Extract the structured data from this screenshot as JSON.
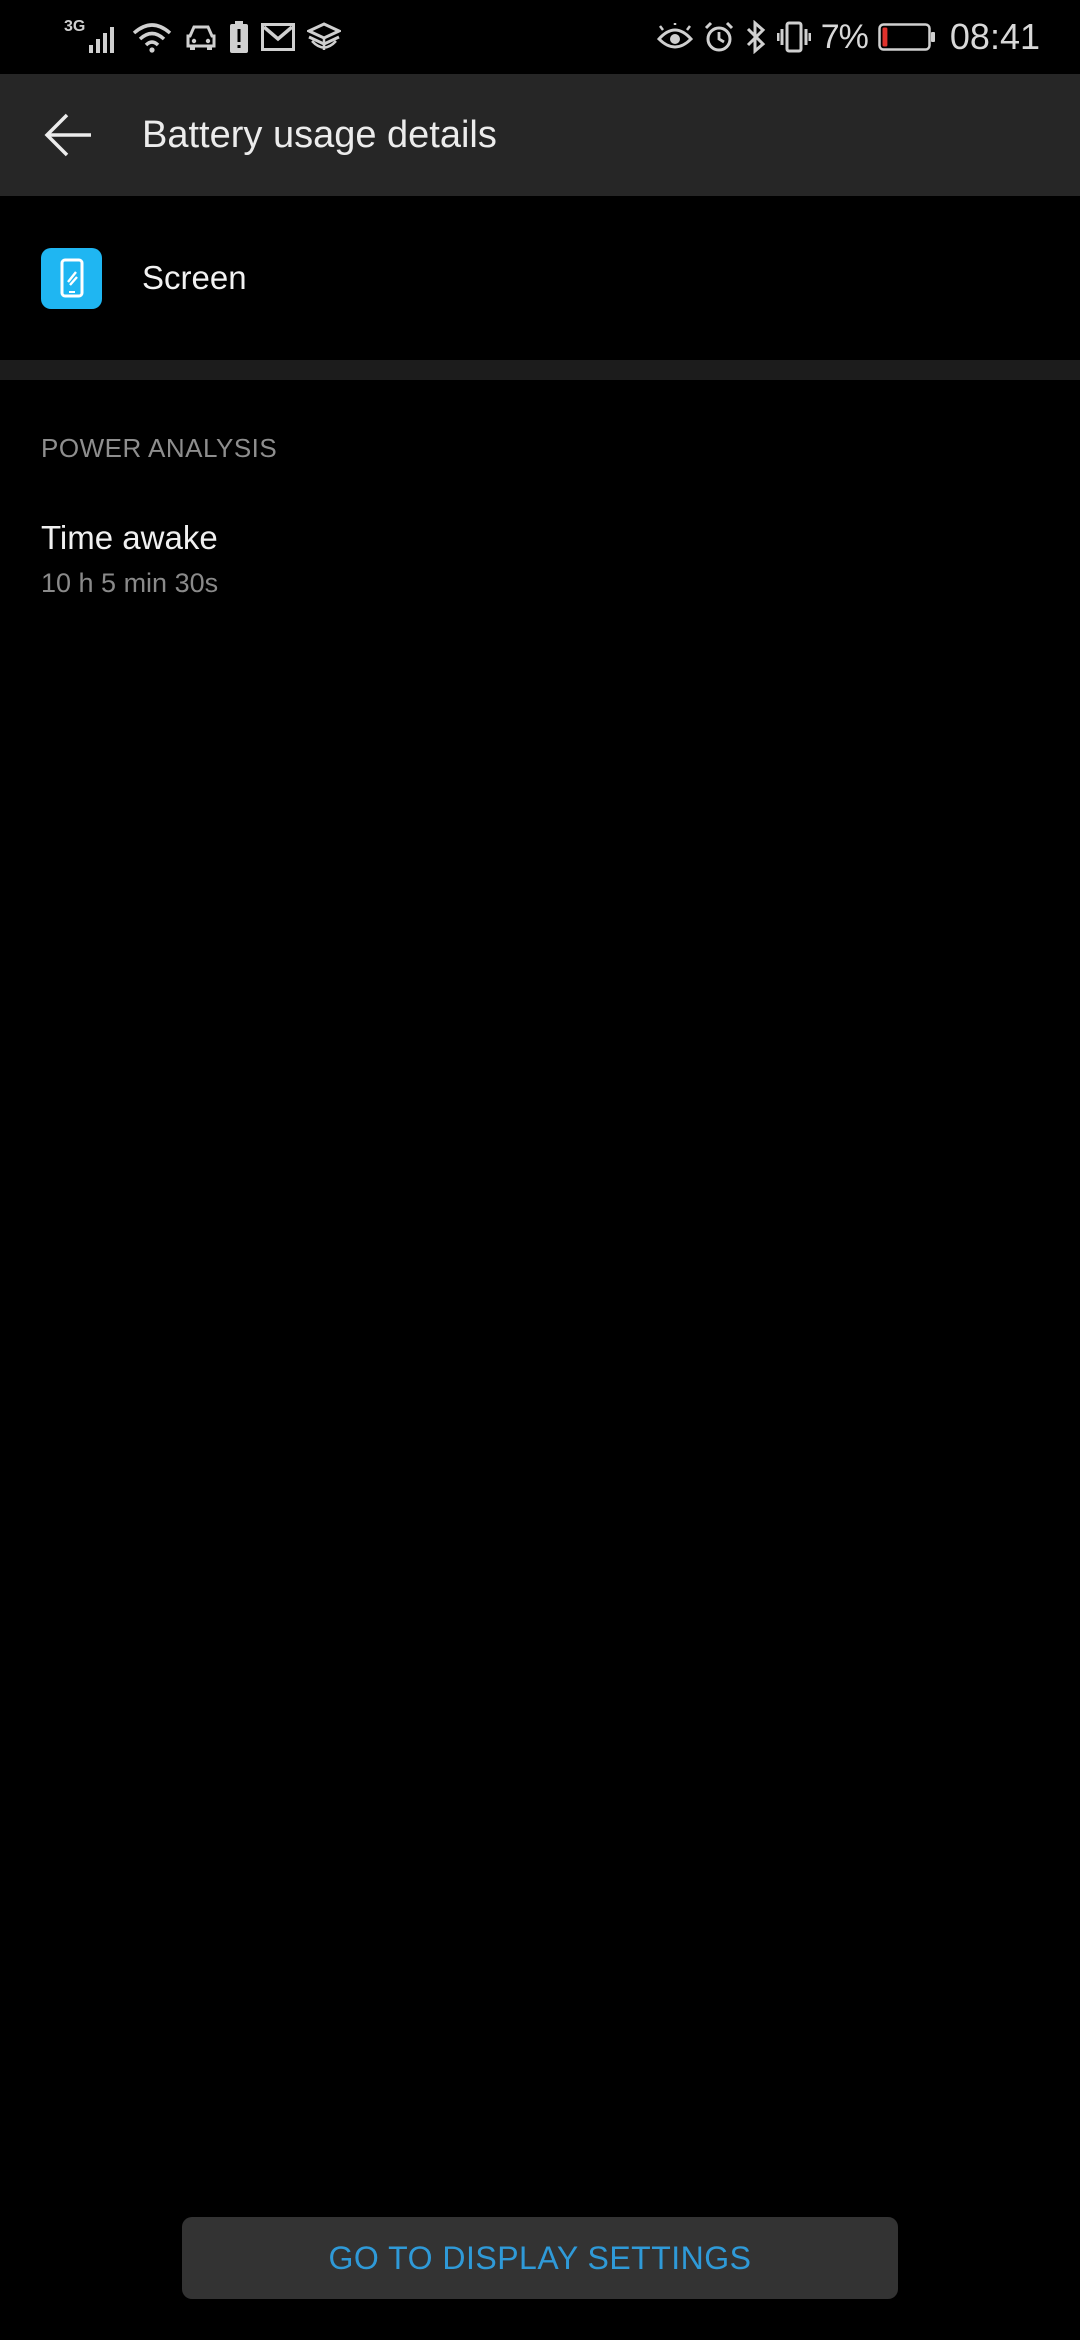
{
  "status_bar": {
    "network_type": "3G",
    "battery_percent": "7%",
    "time": "08:41",
    "left_icons": [
      "signal-icon",
      "wifi-icon",
      "car-icon",
      "battery-alert-icon",
      "gmail-icon",
      "stack-icon"
    ],
    "right_icons": [
      "eye-icon",
      "alarm-icon",
      "bluetooth-icon",
      "vibrate-icon",
      "battery-icon"
    ],
    "battery_level": 0.07,
    "battery_color": "#e0312b"
  },
  "app_bar": {
    "title": "Battery usage details",
    "back_icon": "back-arrow-icon"
  },
  "app_row": {
    "name": "Screen",
    "icon": "screen-brightness-icon",
    "icon_color": "#1fb6f2"
  },
  "power_analysis": {
    "header": "POWER ANALYSIS",
    "items": [
      {
        "title": "Time awake",
        "value": "10 h 5 min 30s"
      }
    ]
  },
  "actions": {
    "display_settings_label": "GO TO DISPLAY SETTINGS",
    "accent_color": "#2f9ad8"
  }
}
